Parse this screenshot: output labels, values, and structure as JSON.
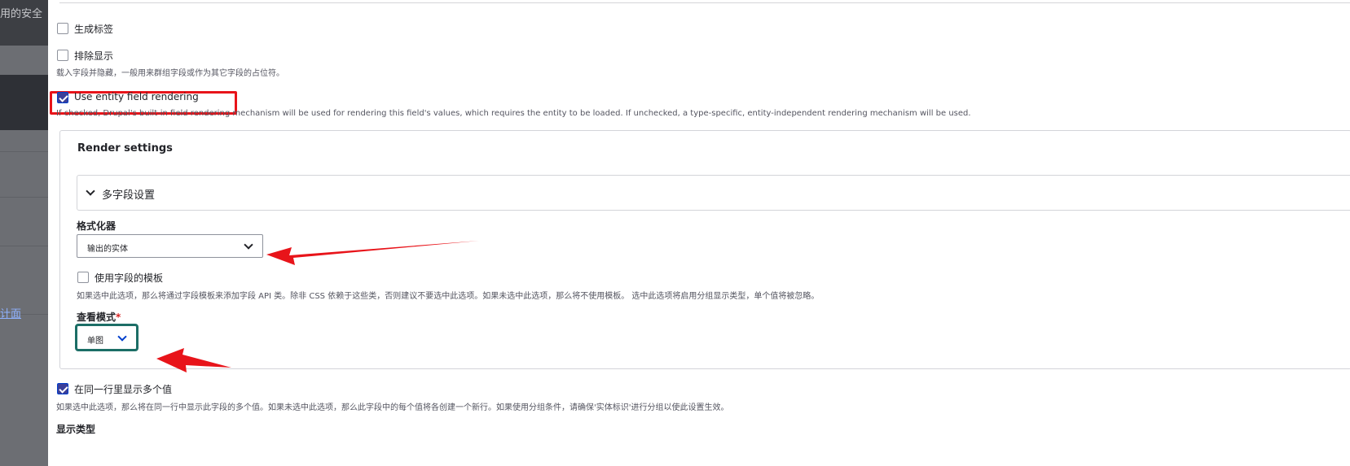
{
  "backdrop": {
    "top_text": "用的安全",
    "link_text": "计面"
  },
  "fields": {
    "generate_label": {
      "label": "生成标签",
      "checked": false
    },
    "exclude": {
      "label": "排除显示",
      "description": "载入字段并隐藏，一般用来群组字段或作为其它字段的占位符。",
      "checked": false
    },
    "entity_rendering": {
      "label": "Use entity field rendering",
      "description": "If checked, Drupal's built-in field rendering mechanism will be used for rendering this field's values, which requires the entity to be loaded. If unchecked, a type-specific, entity-independent rendering mechanism will be used.",
      "checked": true
    }
  },
  "render_settings": {
    "title": "Render settings",
    "multi_field": {
      "label": "多字段设置"
    },
    "formatter": {
      "label": "格式化器",
      "value": "输出的实体"
    },
    "field_template": {
      "label": "使用字段的模板",
      "description": "如果选中此选项，那么将通过字段模板来添加字段 API 类。除非 CSS 依赖于这些类，否则建议不要选中此选项。如果未选中此选项，那么将不使用模板。 选中此选项将启用分组显示类型，单个值将被忽略。",
      "checked": false
    },
    "view_mode": {
      "label": "查看模式",
      "required_mark": "*",
      "value": "单图"
    }
  },
  "multiple_values": {
    "label": "在同一行里显示多个值",
    "description": "如果选中此选项，那么将在同一行中显示此字段的多个值。如果未选中此选项，那么此字段中的每个值将各创建一个新行。如果使用分组条件，请确保'实体标识'进行分组以使此设置生效。",
    "checked": true
  },
  "display_type": {
    "label": "显示类型"
  },
  "colors": {
    "accent": "#3b3f99",
    "highlight": "#e8141a",
    "focus": "#1c6e66",
    "arrow": "#e8141a"
  }
}
